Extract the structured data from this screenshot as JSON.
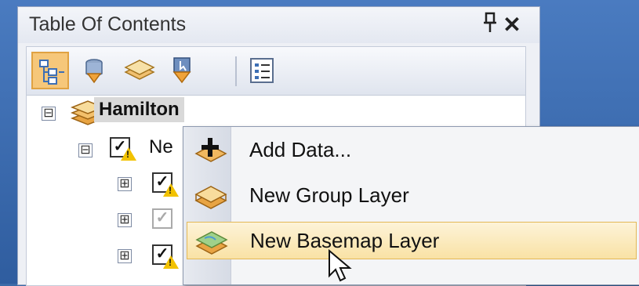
{
  "panel": {
    "title": "Table Of Contents",
    "pin_icon": "pin-icon",
    "close_glyph": "✕"
  },
  "toolbar": {
    "tools": [
      {
        "name": "list-by-drawing-order",
        "icon": "drawing-order-icon",
        "active": true
      },
      {
        "name": "list-by-source",
        "icon": "source-icon",
        "active": false
      },
      {
        "name": "list-by-visibility",
        "icon": "visibility-icon",
        "active": false
      },
      {
        "name": "list-by-selection",
        "icon": "selection-icon",
        "active": false
      },
      {
        "name": "options",
        "icon": "options-icon",
        "active": false
      }
    ]
  },
  "tree": {
    "map_name": "Hamilton",
    "group_label_partial": "Ne",
    "expand_glyph": "⊞",
    "collapse_glyph": "⊟",
    "check_glyph": "✓"
  },
  "context_menu": {
    "items": [
      {
        "label": "Add Data...",
        "icon": "add-data-icon"
      },
      {
        "label": "New Group Layer",
        "icon": "group-layer-icon"
      },
      {
        "label": "New Basemap Layer",
        "icon": "basemap-layer-icon",
        "highlighted": true
      }
    ]
  },
  "colors": {
    "accent_active": "#f6c77a",
    "menu_highlight": "#f9e2a5",
    "warning": "#f2c200"
  }
}
